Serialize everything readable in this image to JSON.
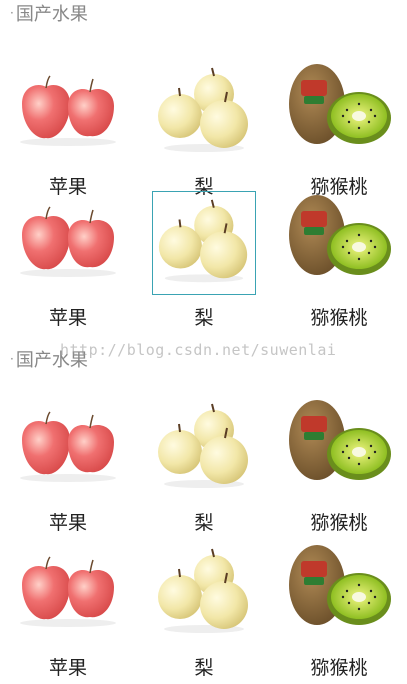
{
  "sections": [
    {
      "title": "国产水果",
      "rows": [
        [
          {
            "label": "苹果",
            "fruit": "apple"
          },
          {
            "label": "梨",
            "fruit": "pear"
          },
          {
            "label": "猕猴桃",
            "fruit": "kiwi"
          }
        ],
        [
          {
            "label": "苹果",
            "fruit": "apple"
          },
          {
            "label": "梨",
            "fruit": "pear",
            "selected": true
          },
          {
            "label": "猕猴桃",
            "fruit": "kiwi"
          }
        ]
      ]
    },
    {
      "title": "国产水果",
      "rows": [
        [
          {
            "label": "苹果",
            "fruit": "apple"
          },
          {
            "label": "梨",
            "fruit": "pear"
          },
          {
            "label": "猕猴桃",
            "fruit": "kiwi"
          }
        ],
        [
          {
            "label": "苹果",
            "fruit": "apple"
          },
          {
            "label": "梨",
            "fruit": "pear"
          },
          {
            "label": "猕猴桃",
            "fruit": "kiwi"
          }
        ]
      ]
    }
  ],
  "watermark": "http://blog.csdn.net/suwenlai",
  "colors": {
    "selection_border": "#3aa3b3",
    "header_text": "#888888"
  }
}
